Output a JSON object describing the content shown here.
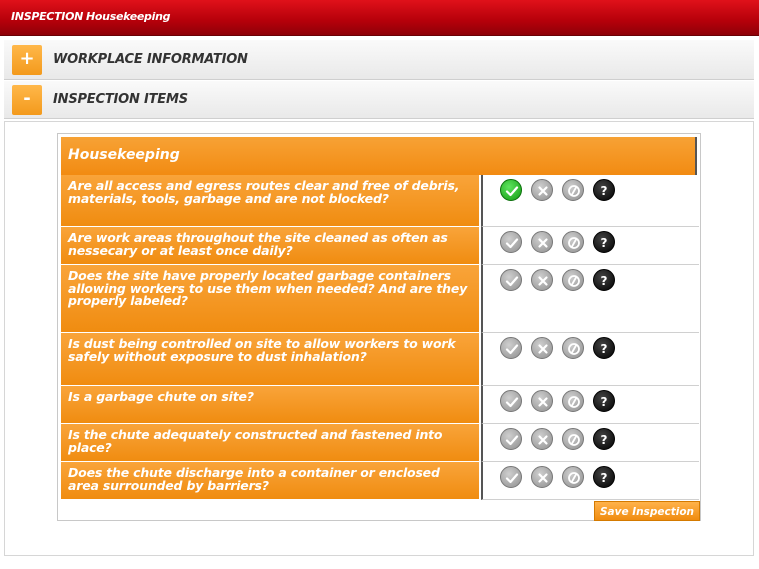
{
  "titlebar": {
    "prefix": "INSPECTION",
    "title": "Housekeeping"
  },
  "sections": [
    {
      "toggle": "+",
      "label": "WORKPLACE INFORMATION"
    },
    {
      "toggle": "-",
      "label": "INSPECTION ITEMS"
    }
  ],
  "table": {
    "heading": "Housekeeping",
    "items": [
      {
        "question": "Are all access and egress routes clear and free of debris, materials, tools, garbage and are not blocked?",
        "selected": "check"
      },
      {
        "question": "Are work areas throughout the site cleaned as often as nessecary or at least once daily?",
        "selected": ""
      },
      {
        "question": "Does the site have properly located garbage containers allowing workers to use them when needed? And are they properly labeled?",
        "selected": ""
      },
      {
        "question": "Is dust being controlled on site to allow workers to work safely without exposure to dust inhalation?",
        "selected": ""
      },
      {
        "question": "Is a garbage chute on site?",
        "selected": ""
      },
      {
        "question": "Is the chute adequately constructed and fastened into place?",
        "selected": ""
      },
      {
        "question": "Does the chute discharge into a container or enclosed area surrounded by barriers?",
        "selected": ""
      }
    ],
    "option_icons": [
      "check-icon",
      "cross-icon",
      "not-applicable-icon",
      "help-icon"
    ],
    "help_glyph": "?"
  },
  "save_label": "Save Inspection",
  "colors": {
    "accent": "#f39a1c",
    "title_red": "#c4000c",
    "selected_green": "#119a11"
  }
}
